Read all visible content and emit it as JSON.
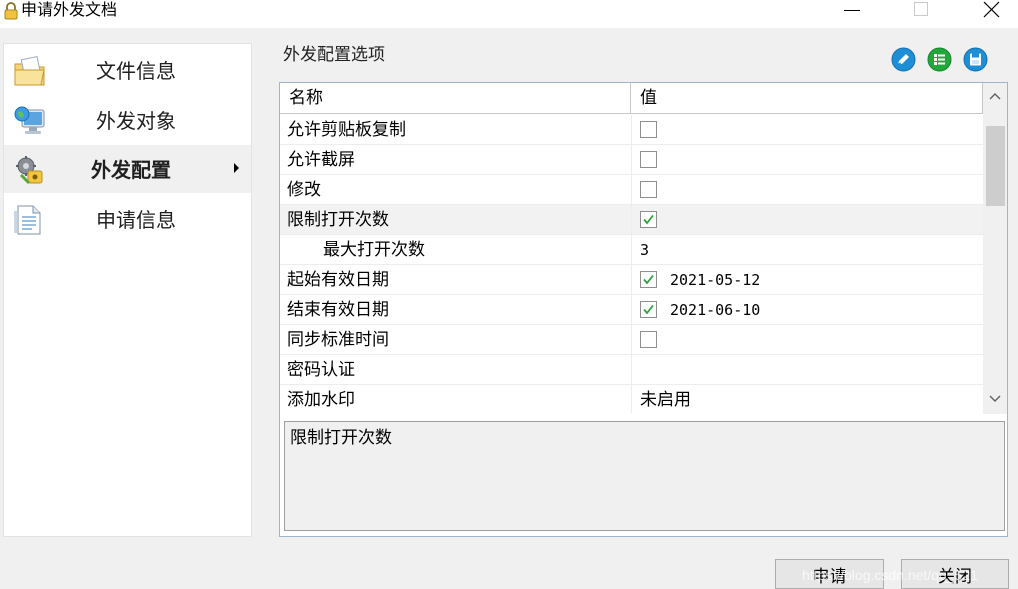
{
  "window": {
    "title": "申请外发文档",
    "icon": "lock-icon",
    "controls": [
      "minimize-icon",
      "maximize-icon",
      "close-icon"
    ]
  },
  "nav": {
    "items": [
      {
        "label": "文件信息",
        "icon": "folder-document-icon",
        "selected": false
      },
      {
        "label": "外发对象",
        "icon": "computer-globe-icon",
        "selected": false
      },
      {
        "label": "外发配置",
        "icon": "gear-key-icon",
        "selected": true
      },
      {
        "label": "申请信息",
        "icon": "document-icon",
        "selected": false
      }
    ]
  },
  "group": {
    "title": "外发配置选项",
    "tools": [
      "edit-icon",
      "list-icon",
      "save-icon"
    ]
  },
  "grid": {
    "columns": {
      "name": "名称",
      "value": "值"
    },
    "rows": [
      {
        "name": "允许剪贴板复制",
        "checkbox": true,
        "checked": false,
        "text": ""
      },
      {
        "name": "允许截屏",
        "checkbox": true,
        "checked": false,
        "text": ""
      },
      {
        "name": "修改",
        "checkbox": true,
        "checked": false,
        "text": ""
      },
      {
        "name": "限制打开次数",
        "checkbox": true,
        "checked": true,
        "text": ""
      },
      {
        "name": "最大打开次数",
        "checkbox": false,
        "checked": false,
        "text": "3"
      },
      {
        "name": "起始有效日期",
        "checkbox": true,
        "checked": true,
        "text": "2021-05-12"
      },
      {
        "name": "结束有效日期",
        "checkbox": true,
        "checked": true,
        "text": "2021-06-10"
      },
      {
        "name": "同步标准时间",
        "checkbox": true,
        "checked": false,
        "text": ""
      },
      {
        "name": "密码认证",
        "checkbox": false,
        "checked": false,
        "text": ""
      },
      {
        "name": "添加水印",
        "checkbox": false,
        "checked": false,
        "text": "未启用"
      }
    ],
    "description": "限制打开次数"
  },
  "buttons": {
    "apply": "申请",
    "close": "关闭"
  },
  "watermark": "https://blog.csdn.net/qq_521",
  "colors": {
    "check": "#2e9e3e",
    "accent_blue": "#1e8fd6",
    "accent_green": "#22a83a"
  }
}
